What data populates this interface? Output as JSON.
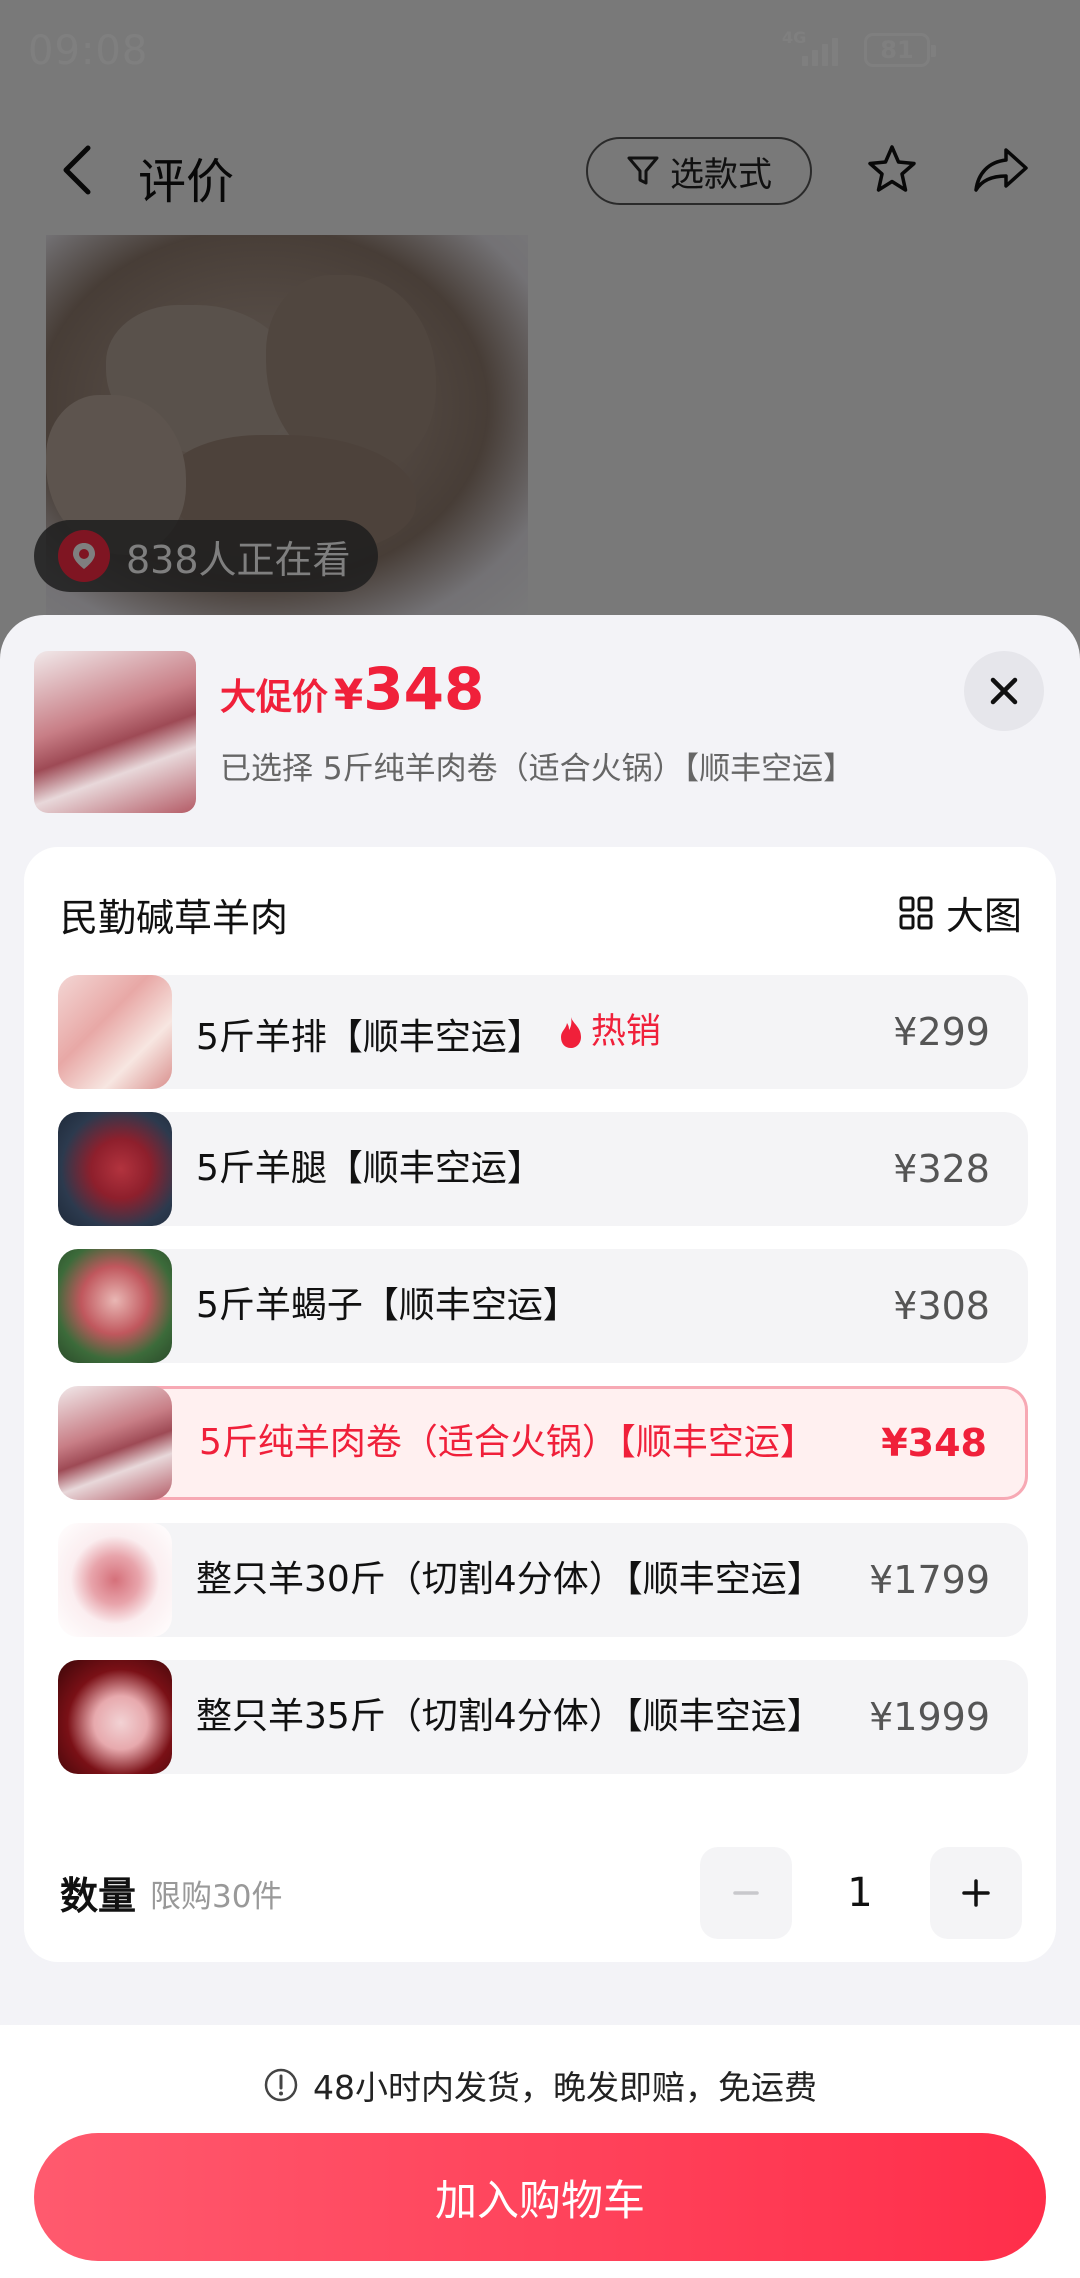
{
  "status": {
    "time": "09:08",
    "network": "4G",
    "battery": "81"
  },
  "nav": {
    "title": "评价",
    "style_select": "选款式"
  },
  "viewer": {
    "text": "838人正在看"
  },
  "sheet": {
    "price_label": "大促价",
    "currency": "¥",
    "price": "348",
    "selected": "已选择 5斤纯羊肉卷（适合火锅）【顺丰空运】"
  },
  "card": {
    "title": "民勤碱草羊肉",
    "big_view": "大图",
    "skus": [
      {
        "name": "5斤羊排【顺丰空运】",
        "badge": "热销",
        "price": "¥299"
      },
      {
        "name": "5斤羊腿【顺丰空运】",
        "price": "¥328"
      },
      {
        "name": "5斤羊蝎子【顺丰空运】",
        "price": "¥308"
      },
      {
        "name": "5斤纯羊肉卷（适合火锅）【顺丰空运】",
        "price": "¥348"
      },
      {
        "name": "整只羊30斤（切割4分体）【顺丰空运】",
        "price": "¥1799"
      },
      {
        "name": "整只羊35斤（切割4分体）【顺丰空运】",
        "price": "¥1999"
      }
    ],
    "qty_label": "数量",
    "qty_limit": "限购30件",
    "qty_value": "1"
  },
  "footer": {
    "notice": "48小时内发货，晚发即赔，免运费",
    "cart_button": "加入购物车"
  },
  "colors": {
    "accent": "#f0203a",
    "selected_border": "#f7a9b4",
    "button": "#ff2e4a"
  }
}
